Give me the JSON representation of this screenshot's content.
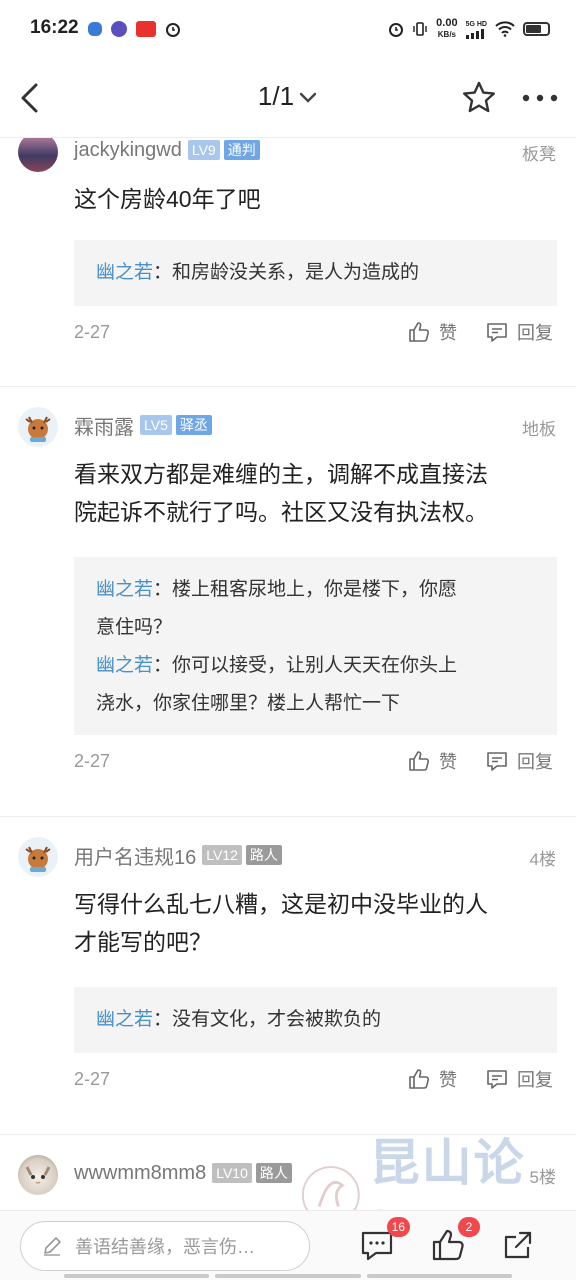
{
  "status_bar": {
    "time": "16:22",
    "net_speed_value": "0.00",
    "net_speed_unit": "KB/s",
    "network": "5G HD"
  },
  "nav": {
    "page_indicator": "1/1",
    "icons": [
      "back-arrow-icon",
      "chevron-down-icon",
      "star-icon",
      "more-icon"
    ]
  },
  "posts": [
    {
      "username": "jackykingwd",
      "level": "LV9",
      "title": "通判",
      "floor": "板凳",
      "content": "这个房龄40年了吧",
      "replies": [
        {
          "author": "幽之若",
          "sep": "：",
          "text": "和房龄没关系，是人为造成的"
        }
      ],
      "date": "2-27",
      "like_label": "赞",
      "reply_label": "回复"
    },
    {
      "username": "霖雨露",
      "level": "LV5",
      "title": "驿丞",
      "floor": "地板",
      "content_lines": [
        "看来双方都是难缠的主，调解不成直接法",
        "院起诉不就行了吗。社区又没有执法权。"
      ],
      "replies": [
        {
          "author": "幽之若",
          "sep": "：",
          "text_lines": [
            "楼上租客尿地上，你是楼下，你愿",
            "意住吗？"
          ]
        },
        {
          "author": "幽之若",
          "sep": "：",
          "text_lines": [
            "你可以接受，让别人天天在你头上",
            "浇水，你家住哪里？楼上人帮忙一下"
          ]
        }
      ],
      "date": "2-27",
      "like_label": "赞",
      "reply_label": "回复"
    },
    {
      "username": "用户名违规16",
      "level": "LV12",
      "title": "路人",
      "floor": "4楼",
      "content_lines": [
        "写得什么乱七八糟，这是初中没毕业的人",
        "才能写的吧？"
      ],
      "replies": [
        {
          "author": "幽之若",
          "sep": "：",
          "text": "没有文化，才会被欺负的"
        }
      ],
      "date": "2-27",
      "like_label": "赞",
      "reply_label": "回复"
    },
    {
      "username": "wwwmm8mm8",
      "level": "LV10",
      "title": "路人",
      "floor": "5楼"
    }
  ],
  "bottom_bar": {
    "input_placeholder": "善语结善缘，恶言伤…",
    "comment_count": "16",
    "like_count": "2"
  },
  "watermark": {
    "text": "昆山论坛"
  },
  "colors": {
    "accent_blue": "#4a90c8",
    "level_badge": "#a9c7ec",
    "title_badge": "#6fa6e6",
    "badge_red": "#f0484c"
  }
}
